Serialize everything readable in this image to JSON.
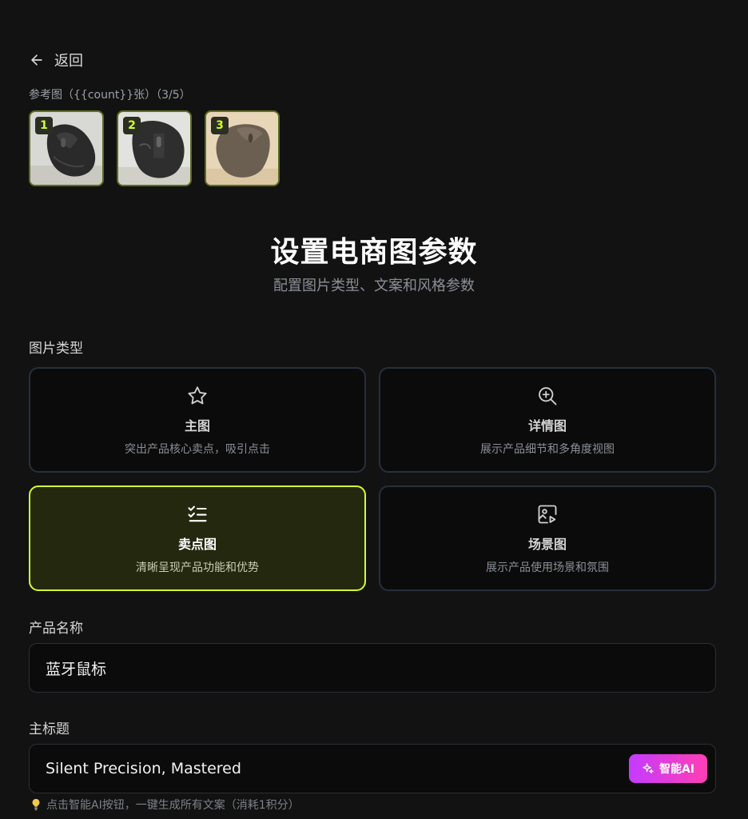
{
  "header": {
    "back_label": "返回"
  },
  "reference": {
    "label": "参考图（{{count}}张）（3/5）",
    "images": [
      {
        "index": "1",
        "tone": "dark-mouse"
      },
      {
        "index": "2",
        "tone": "dark-mouse"
      },
      {
        "index": "3",
        "tone": "beige-mouse"
      }
    ]
  },
  "hero": {
    "title": "设置电商图参数",
    "subtitle": "配置图片类型、文案和风格参数"
  },
  "image_type": {
    "label": "图片类型",
    "options": [
      {
        "title": "主图",
        "desc": "突出产品核心卖点，吸引点击",
        "icon": "star-icon",
        "selected": false
      },
      {
        "title": "详情图",
        "desc": "展示产品细节和多角度视图",
        "icon": "zoom-in-icon",
        "selected": false
      },
      {
        "title": "卖点图",
        "desc": "清晰呈现产品功能和优势",
        "icon": "checklist-icon",
        "selected": true
      },
      {
        "title": "场景图",
        "desc": "展示产品使用场景和氛围",
        "icon": "image-play-icon",
        "selected": false
      }
    ]
  },
  "product_name": {
    "label": "产品名称",
    "value": "蓝牙鼠标"
  },
  "main_title": {
    "label": "主标题",
    "value": "Silent Precision, Mastered",
    "ai_button": "智能AI"
  },
  "hint": {
    "text": "点击智能AI按钮，一键生成所有文案（消耗1积分）",
    "icon": "lightbulb-icon"
  },
  "colors": {
    "accent": "#d4ff29",
    "ai_gradient_start": "#c43bff",
    "ai_gradient_end": "#ff3fb4"
  }
}
